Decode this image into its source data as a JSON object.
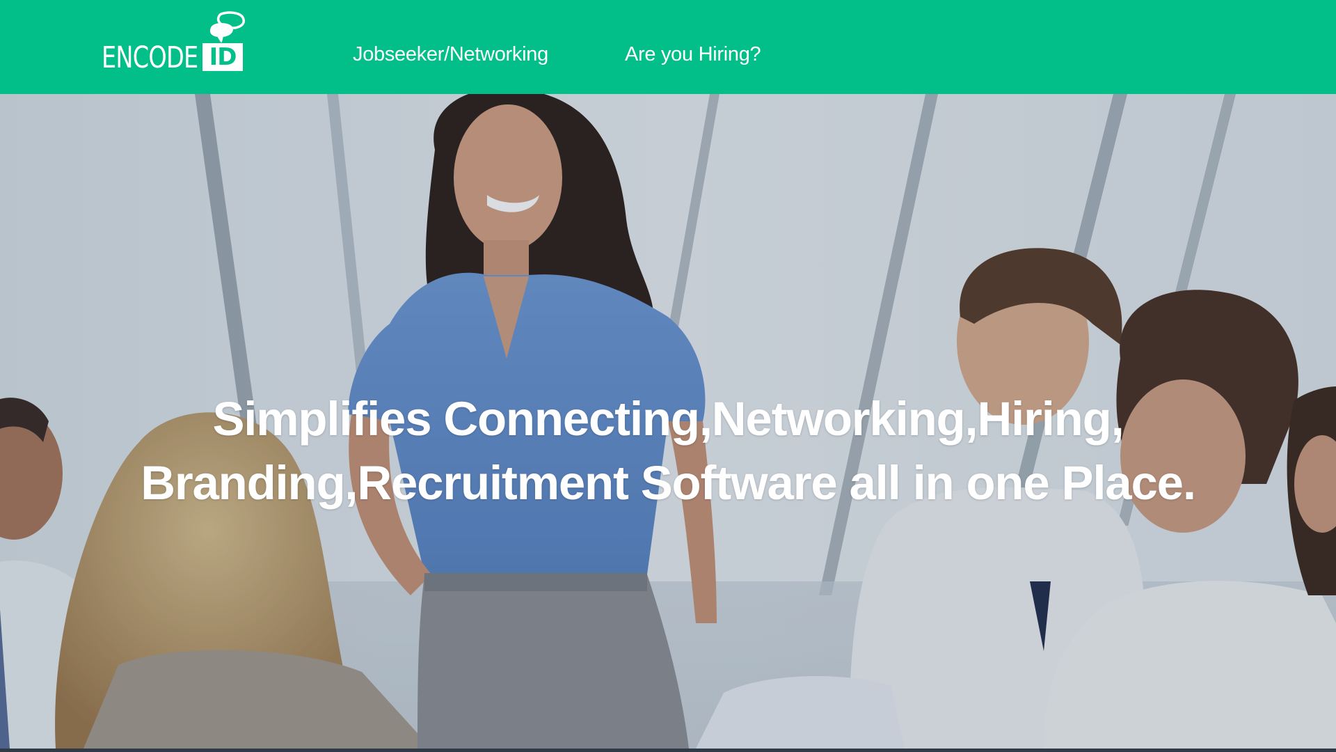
{
  "header": {
    "logo": {
      "wordmark": "ENCODE",
      "badge": "ID",
      "icon": "speech-bubbles-icon"
    },
    "nav": {
      "jobseeker": "Jobseeker/Networking",
      "hiring": "Are you Hiring?"
    }
  },
  "hero": {
    "headline_line1": "Simplifies Connecting,Networking,Hiring,",
    "headline_line2": "Branding,Recruitment Software all in one Place."
  },
  "colors": {
    "brand": "#02bf8a",
    "text_on_brand": "#ffffff",
    "footer_strip": "#2f3b46"
  }
}
